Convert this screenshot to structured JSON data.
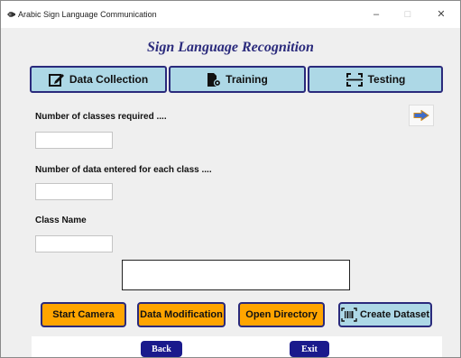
{
  "window": {
    "title": "Arabic Sign Language Communication",
    "minimize": "–",
    "maximize": "□",
    "close": "✕"
  },
  "header": {
    "title": "Sign Language Recognition"
  },
  "tabs": [
    {
      "label": "Data Collection",
      "icon": "edit-icon"
    },
    {
      "label": "Training",
      "icon": "document-gear-icon"
    },
    {
      "label": "Testing",
      "icon": "scan-frame-icon"
    }
  ],
  "form": {
    "classes_label": "Number of classes required ....",
    "classes_value": "",
    "data_count_label": "Number of data entered for each class ....",
    "data_count_value": "",
    "class_name_label": "Class Name",
    "class_name_value": ""
  },
  "output": {
    "text": ""
  },
  "actions": {
    "start_camera": "Start Camera",
    "data_modification": "Data Modification",
    "open_directory": "Open Directory",
    "create_dataset": "Create Dataset"
  },
  "nav": {
    "back": "Back",
    "exit": "Exit"
  },
  "colors": {
    "heading": "#2a2a7c",
    "tab_bg": "#add8e6",
    "action_bg": "#ffa500",
    "nav_bg": "#1a1a8c",
    "window_bg": "#efefef"
  }
}
